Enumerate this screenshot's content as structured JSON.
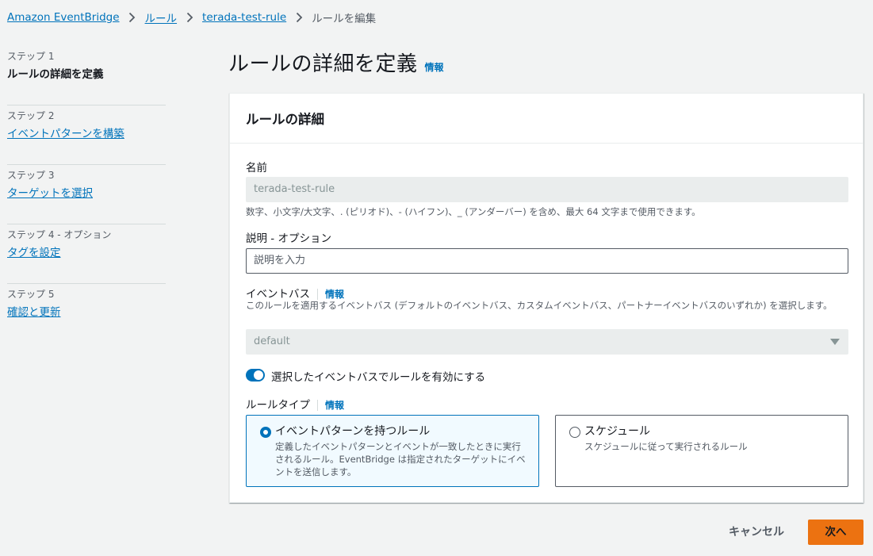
{
  "breadcrumb": {
    "items": [
      "Amazon EventBridge",
      "ルール",
      "terada-test-rule"
    ],
    "current": "ルールを編集"
  },
  "steps": [
    {
      "num": "ステップ 1",
      "label": "ルールの詳細を定義"
    },
    {
      "num": "ステップ 2",
      "label": "イベントパターンを構築"
    },
    {
      "num": "ステップ 3",
      "label": "ターゲットを選択"
    },
    {
      "num": "ステップ 4 - オプション",
      "label": "タグを設定"
    },
    {
      "num": "ステップ 5",
      "label": "確認と更新"
    }
  ],
  "page": {
    "title": "ルールの詳細を定義",
    "info": "情報"
  },
  "panel": {
    "header": "ルールの詳細",
    "name_label": "名前",
    "name_value": "terada-test-rule",
    "name_hint": "数字、小文字/大文字、. (ピリオド)、- (ハイフン)、_ (アンダーバー) を含め、最大 64 文字まで使用できます。",
    "desc_label": "説明 - オプション",
    "desc_placeholder": "説明を入力",
    "bus_label": "イベントバス",
    "bus_info": "情報",
    "bus_hint": "このルールを適用するイベントバス (デフォルトのイベントバス、カスタムイベントバス、パートナーイベントバスのいずれか) を選択します。",
    "bus_value": "default",
    "toggle_label": "選択したイベントバスでルールを有効にする",
    "rule_type_label": "ルールタイプ",
    "rule_type_info": "情報",
    "tiles": [
      {
        "title": "イベントパターンを持つルール",
        "desc": "定義したイベントパターンとイベントが一致したときに実行されるルール。EventBridge は指定されたターゲットにイベントを送信します。"
      },
      {
        "title": "スケジュール",
        "desc": "スケジュールに従って実行されるルール"
      }
    ]
  },
  "footer": {
    "cancel": "キャンセル",
    "next": "次へ"
  },
  "colors": {
    "link": "#0073bb",
    "primary_button": "#ec7211",
    "background": "#f2f3f3"
  }
}
